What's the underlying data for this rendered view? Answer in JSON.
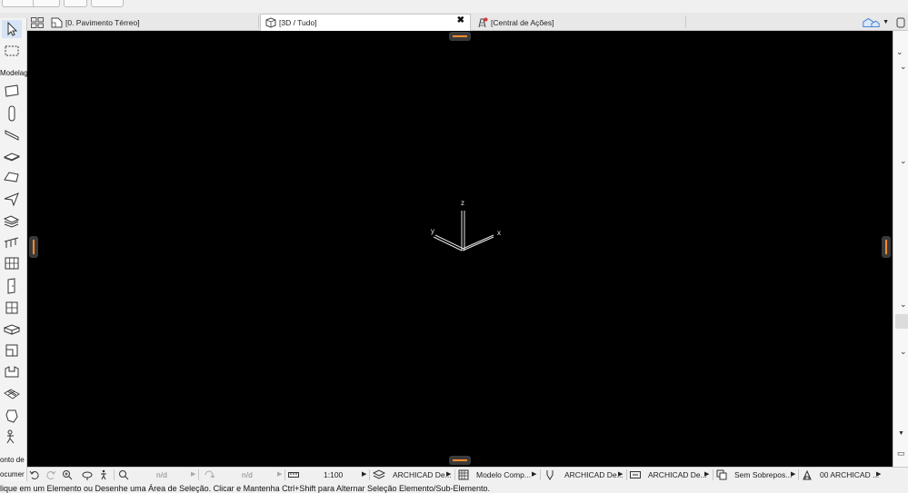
{
  "tabs": [
    {
      "label": "[0. Pavimento Térreo]",
      "icon": "floor-plan-icon"
    },
    {
      "label": "[3D / Tudo]",
      "icon": "3d-window-icon",
      "close": "✖"
    },
    {
      "label": "[Central de Ações]",
      "icon": "action-center-icon"
    }
  ],
  "toolbox": {
    "label_design": "Modelag",
    "label_point": "onto de",
    "label_doc": "ocumer"
  },
  "viewport": {
    "axes": {
      "z": "z",
      "y": "y",
      "x": "x"
    }
  },
  "optbar": {
    "nd1": "n/d",
    "nd2": "n/d",
    "scale": "1:100",
    "layer": "ARCHICAD De...",
    "model": "Modelo Comp...",
    "pen": "ARCHICAD De...",
    "dim": "ARCHICAD De...",
    "override": "Sem Sobrepos...",
    "renovation": "00 ARCHICAD ..."
  },
  "status": {
    "text": "lique em um Elemento ou Desenhe uma Área de Seleção. Clicar e Mantenha Ctrl+Shift para Alternar Seleção Elemento/Sub-Elemento."
  },
  "colors": {
    "viewport_bg": "#000000",
    "handle_accent": "#ff8a2a",
    "selected_tool": "#d6e4f5"
  }
}
